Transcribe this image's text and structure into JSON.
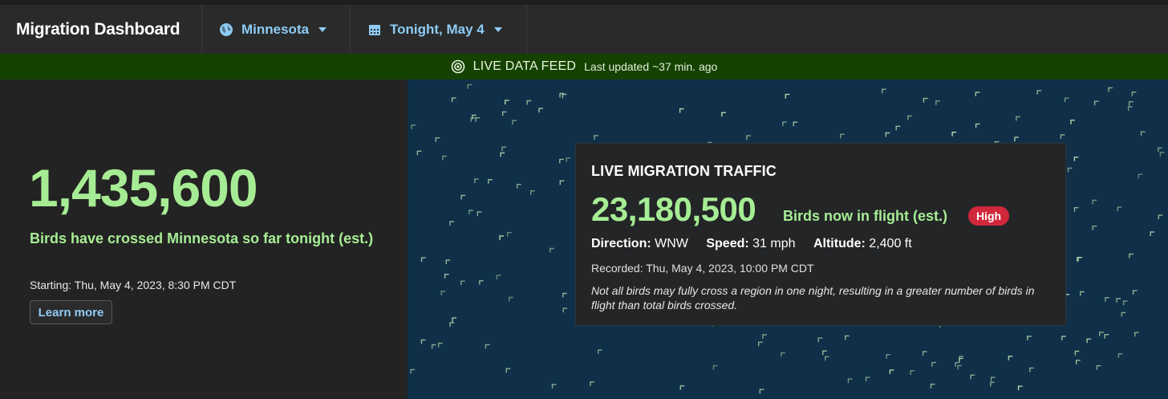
{
  "header": {
    "title": "Migration Dashboard",
    "region": {
      "label": "Minnesota",
      "icon": "globe-icon"
    },
    "date": {
      "label": "Tonight, May 4",
      "icon": "calendar-icon"
    }
  },
  "live_bar": {
    "icon": "broadcast-icon",
    "label": "LIVE DATA FEED",
    "updated": "Last updated ~37 min. ago",
    "background_color": "#154200"
  },
  "summary": {
    "count": "1,435,600",
    "label": "Birds have crossed Minnesota so far tonight (est.)",
    "starting": "Starting: Thu, May 4, 2023, 8:30 PM CDT",
    "learn_more_label": "Learn more",
    "accent_color": "#a6ec94"
  },
  "traffic": {
    "title": "LIVE MIGRATION TRAFFIC",
    "count": "23,180,500",
    "in_flight_label": "Birds now in flight (est.)",
    "intensity_badge": "High",
    "badge_color": "#d0273a",
    "direction_label": "Direction:",
    "direction_value": "WNW",
    "speed_label": "Speed:",
    "speed_value": "31 mph",
    "altitude_label": "Altitude:",
    "altitude_value": "2,400 ft",
    "recorded": "Recorded: Thu, May 4, 2023, 10:00 PM CDT",
    "note": "Not all birds may fully cross a region in one night, resulting in a greater number of birds in flight than total birds crossed."
  },
  "map": {
    "background_color": "#0f3048",
    "bird_icon": "bird-chevron-icon"
  }
}
